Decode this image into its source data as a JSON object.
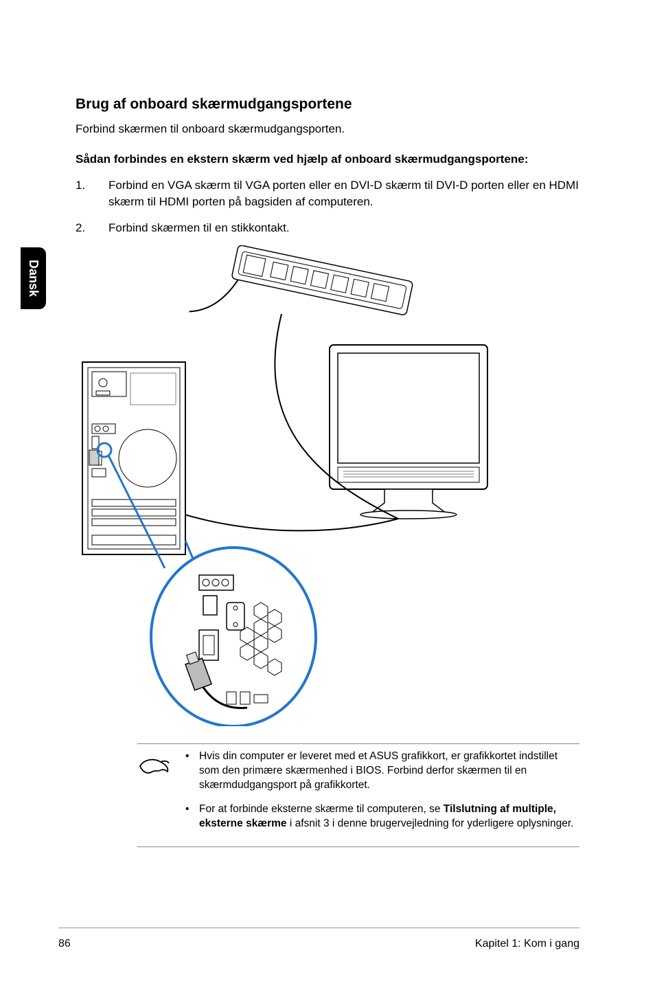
{
  "sideTab": "Dansk",
  "heading": "Brug af onboard skærmudgangsportene",
  "intro": "Forbind skærmen til onboard skærmudgangsporten.",
  "subheading": "Sådan forbindes en ekstern skærm ved hjælp af onboard skærmudgangsportene:",
  "steps": [
    {
      "num": "1.",
      "text": "Forbind en VGA skærm til VGA porten eller en DVI-D skærm til DVI-D porten eller en HDMI skærm til HDMI porten på bagsiden af computeren."
    },
    {
      "num": "2.",
      "text": "Forbind skærmen til en stikkontakt."
    }
  ],
  "notes": [
    {
      "prefix": "Hvis din computer er leveret med et ASUS grafikkort, er grafikkortet indstillet som den primære skærmenhed i BIOS. Forbind derfor skærmen til en skærmdudgangsport på grafikkortet.",
      "bold": "",
      "suffix": ""
    },
    {
      "prefix": "For at forbinde eksterne skærme til computeren, se ",
      "bold": "Tilslutning af multiple, eksterne skærme",
      "suffix": " i afsnit 3 i denne brugervejledning for yderligere oplysninger."
    }
  ],
  "footer": {
    "pageNum": "86",
    "chapter": "Kapitel 1: Kom i gang"
  }
}
